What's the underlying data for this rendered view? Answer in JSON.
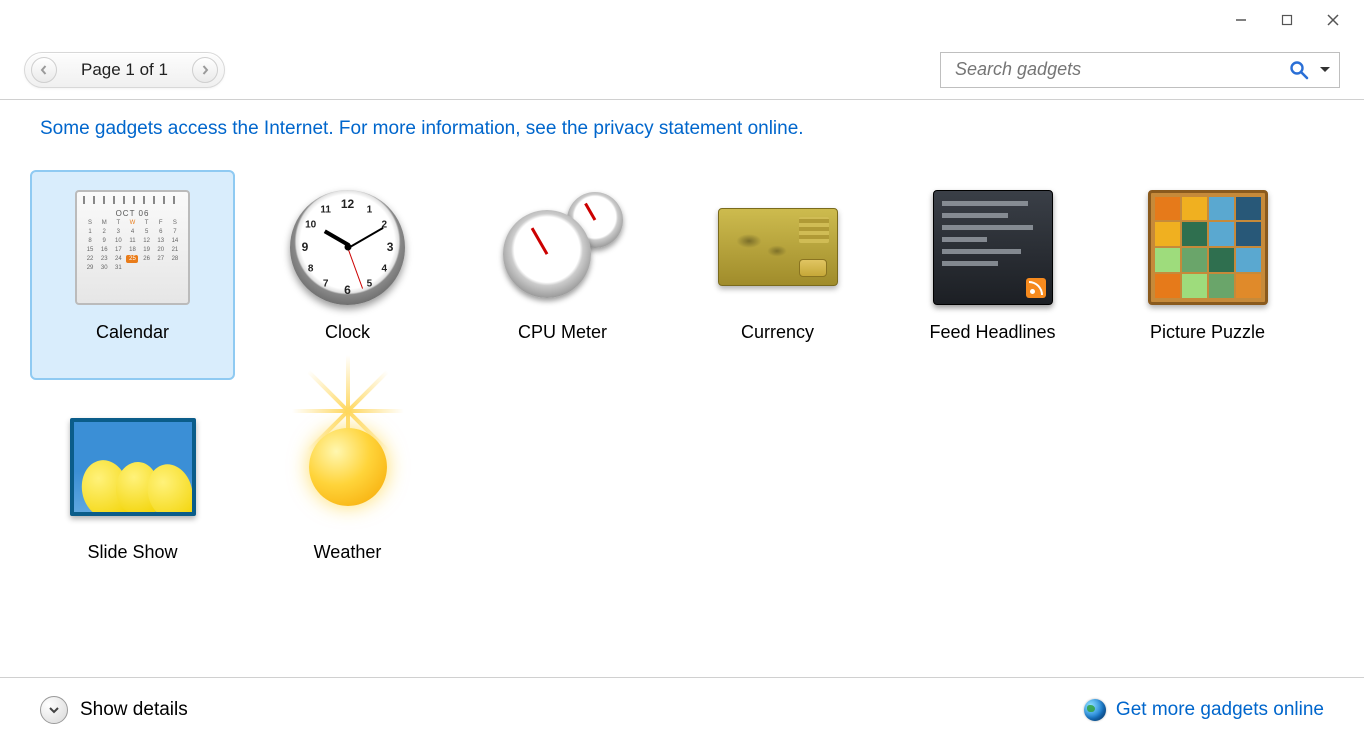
{
  "titlebar": {},
  "toolbar": {
    "pager_label": "Page 1 of 1",
    "search_placeholder": "Search gadgets"
  },
  "banner": {
    "text": "Some gadgets access the Internet.  For more information, see the privacy statement online."
  },
  "gadgets": [
    {
      "name": "Calendar",
      "icon": "calendar",
      "selected": true
    },
    {
      "name": "Clock",
      "icon": "clock",
      "selected": false
    },
    {
      "name": "CPU Meter",
      "icon": "cpu-meter",
      "selected": false
    },
    {
      "name": "Currency",
      "icon": "currency",
      "selected": false
    },
    {
      "name": "Feed Headlines",
      "icon": "feed",
      "selected": false
    },
    {
      "name": "Picture Puzzle",
      "icon": "puzzle",
      "selected": false
    },
    {
      "name": "Slide Show",
      "icon": "slideshow",
      "selected": false
    },
    {
      "name": "Weather",
      "icon": "weather",
      "selected": false
    }
  ],
  "footer": {
    "details_label": "Show details",
    "online_label": "Get more gadgets online"
  }
}
